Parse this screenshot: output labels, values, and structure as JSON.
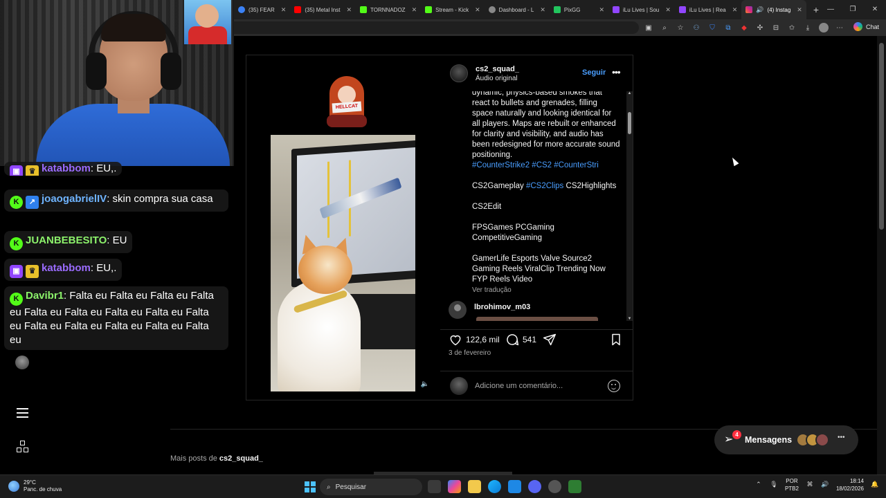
{
  "browser": {
    "tabs": [
      {
        "label": "(35) FEAR",
        "icon": "youtube-icon",
        "color": "#3b82f6"
      },
      {
        "label": "(35) Metal Inst",
        "icon": "youtube-icon",
        "color": "#ff0000"
      },
      {
        "label": "TORNNADOZ",
        "icon": "kick-icon",
        "color": "#53fc18"
      },
      {
        "label": "Stream - Kick",
        "icon": "kick-icon",
        "color": "#53fc18"
      },
      {
        "label": "Dashboard - L",
        "icon": "dashboard-icon",
        "color": "#888888"
      },
      {
        "label": "PixGG",
        "icon": "pixgg-icon",
        "color": "#22c55e"
      },
      {
        "label": "iLu Lives | Sou",
        "icon": "twitch-icon",
        "color": "#9146ff"
      },
      {
        "label": "iLu Lives | Rea",
        "icon": "twitch-icon",
        "color": "#9146ff"
      },
      {
        "label": "(4) Instag",
        "icon": "instagram-icon",
        "color": "#e1306c",
        "active": true
      }
    ],
    "chat_button": "Chat"
  },
  "post": {
    "username": "cs2_squad_",
    "audio": "Áudio original",
    "follow": "Seguir",
    "caption": {
      "lead": "dynamic, physics-based smokes that react to bullets and grenades, filling space naturally and looking identical for all players. Maps are rebuilt or enhanced for clarity and visibility, and audio has been redesigned for more accurate sound positioning.",
      "hashtags_1": "#CounterStrike2 #CS2 #CounterStri",
      "line_2a": "CS2Gameplay ",
      "line_2b": "#CS2Clips",
      "line_2c": " CS2Highlights",
      "line_3": "CS2Edit",
      "line_4": "FPSGames PCGaming CompetitiveGaming",
      "line_5": "GamerLife Esports Valve Source2 Gaming Reels ViralClip Trending Now FYP Reels Video",
      "translate": "Ver tradução"
    },
    "comment_user": "lbrohimov_m03",
    "likes": "122,6 mil",
    "comments": "541",
    "date": "3 de fevereiro",
    "add_comment_placeholder": "Adicione um comentário...",
    "sticker_text": "HELLCAT"
  },
  "more_posts": {
    "prefix": "Mais posts de ",
    "user": "cs2_squad_"
  },
  "messages": {
    "label": "Mensagens",
    "badge": "4"
  },
  "stream_chat": [
    {
      "user": "katabbom",
      "text": "EU,.",
      "platform": "twitch"
    },
    {
      "user": "joaogabrielIV",
      "text": "skin compra sua casa",
      "platform": "kick"
    },
    {
      "user": "JUANBEBESITO",
      "text": "EU",
      "platform": "kick"
    },
    {
      "user": "katabbom",
      "text": "EU,.",
      "platform": "twitch"
    },
    {
      "user": "Davibr1",
      "text": "Falta eu Falta eu Falta eu Falta eu Falta eu Falta eu Falta eu Falta eu Falta eu Falta eu Falta eu Falta eu Falta eu Falta eu",
      "platform": "kick"
    }
  ],
  "taskbar": {
    "temp": "29°C",
    "weather": "Panc. de chuva",
    "search": "Pesquisar",
    "lang1": "POR",
    "lang2": "PTB2",
    "time": "18:14",
    "date": "18/02/2026"
  },
  "colors": {
    "accent_blue": "#4a9eff",
    "kick_green": "#53fc18",
    "twitch_purple": "#9146ff",
    "notif_red": "#ff3040"
  }
}
